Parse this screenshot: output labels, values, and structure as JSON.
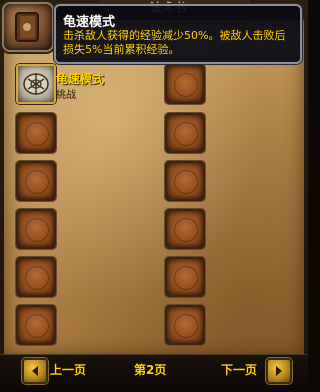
{
  "book": {
    "title": "法术书"
  },
  "tooltip": {
    "title": "龟速模式",
    "description": "击杀敌人获得的经验减少50%。被敌人击败后损失5%当前累积经验。"
  },
  "spells": [
    {
      "name": "龟速模式",
      "rank": "挑战",
      "icon": "turtle-shell-icon"
    }
  ],
  "slots": {
    "total": 12,
    "filled": 1
  },
  "nav": {
    "prev_label": "上一页",
    "next_label": "下一页",
    "page": "第2页"
  },
  "colors": {
    "gold_text": "#ffd100",
    "tooltip_bg": "#0a0a14",
    "slot_empty": "#8c4a1d",
    "parchment": "#b88d52"
  }
}
